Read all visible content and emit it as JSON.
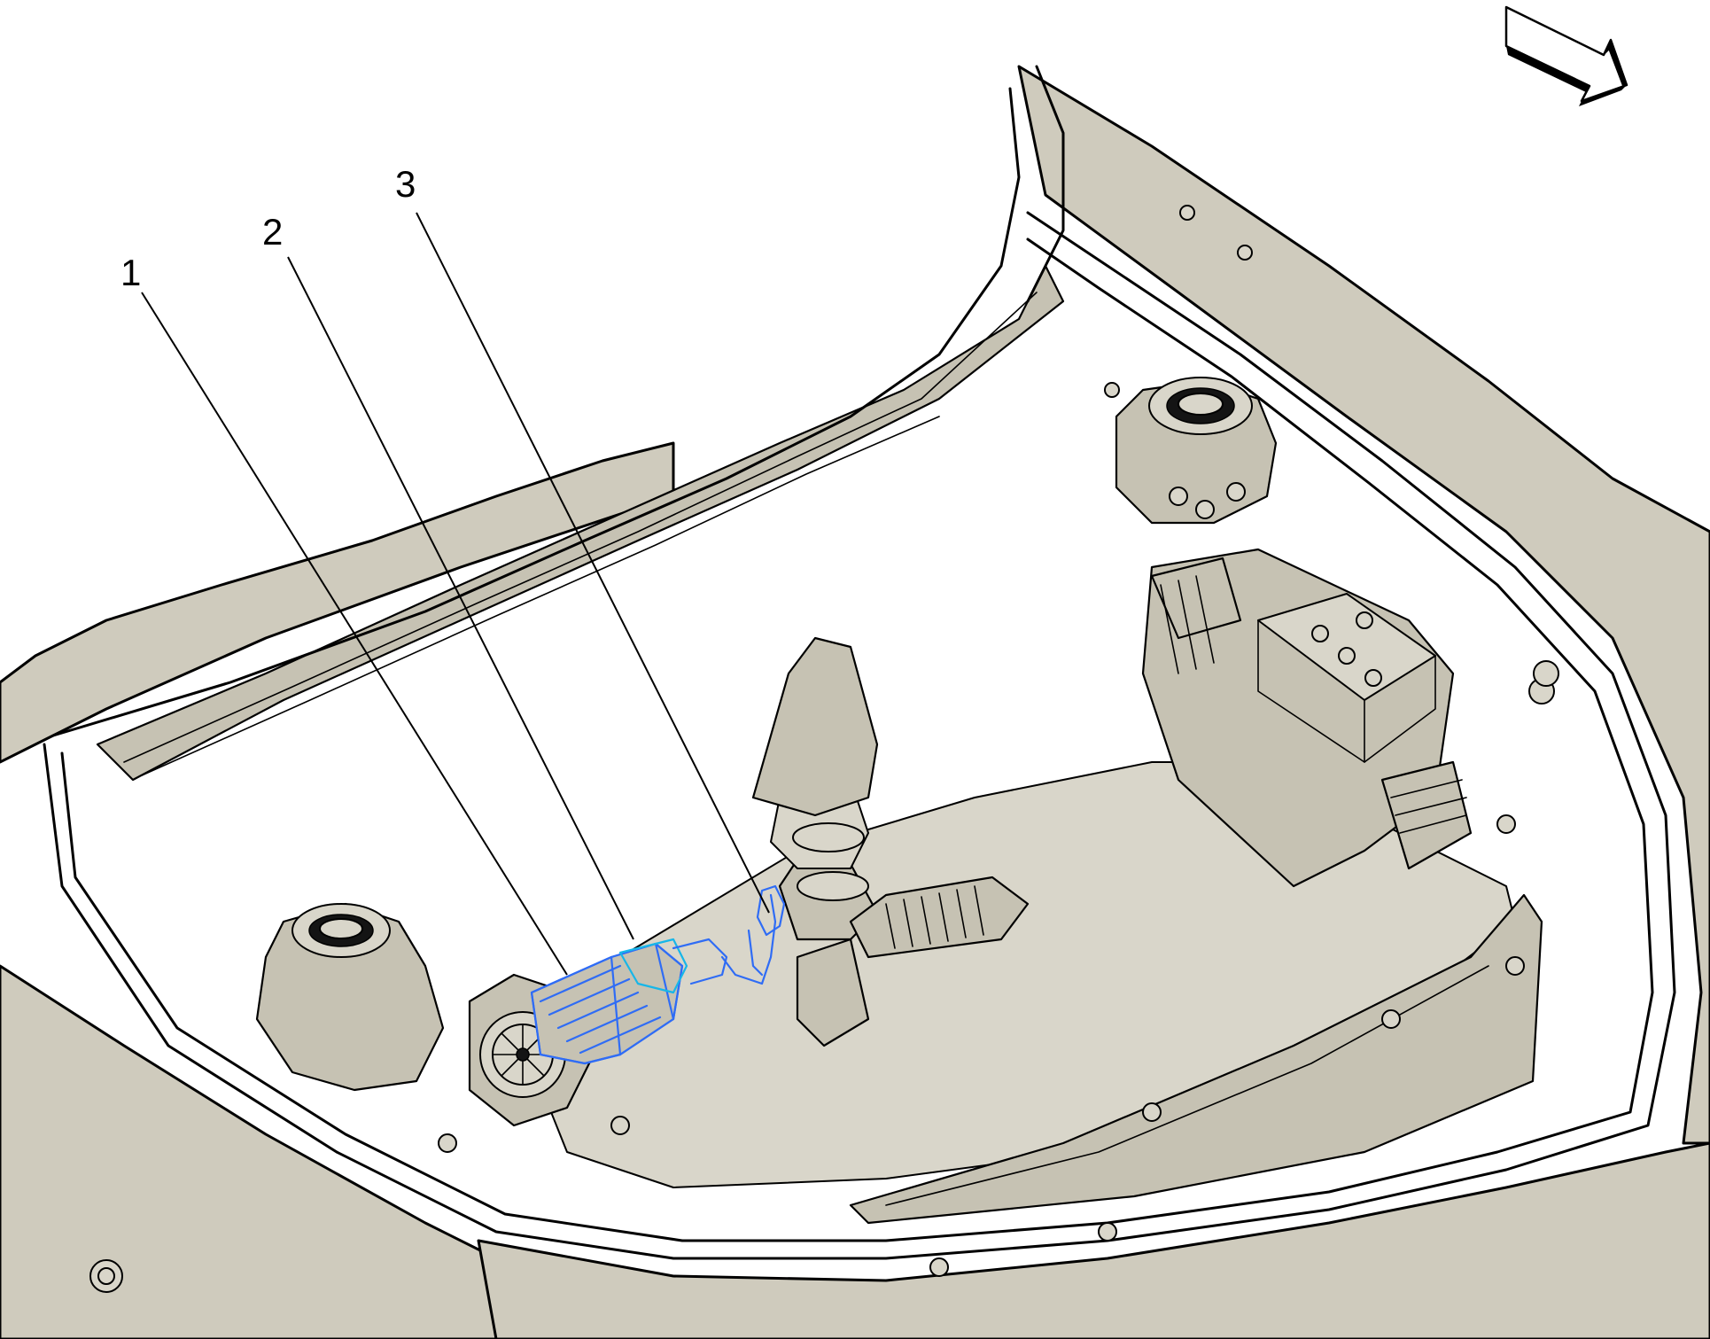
{
  "callouts": [
    {
      "label": "1"
    },
    {
      "label": "2"
    },
    {
      "label": "3"
    }
  ],
  "icons": {
    "view_arrow": "view-direction-arrow-icon"
  },
  "colors": {
    "body": "#cfcbbd",
    "body_shade": "#c6c2b3",
    "line": "#000000",
    "highlight": "#2f6cf5",
    "highlight_alt": "#17b6e8"
  }
}
